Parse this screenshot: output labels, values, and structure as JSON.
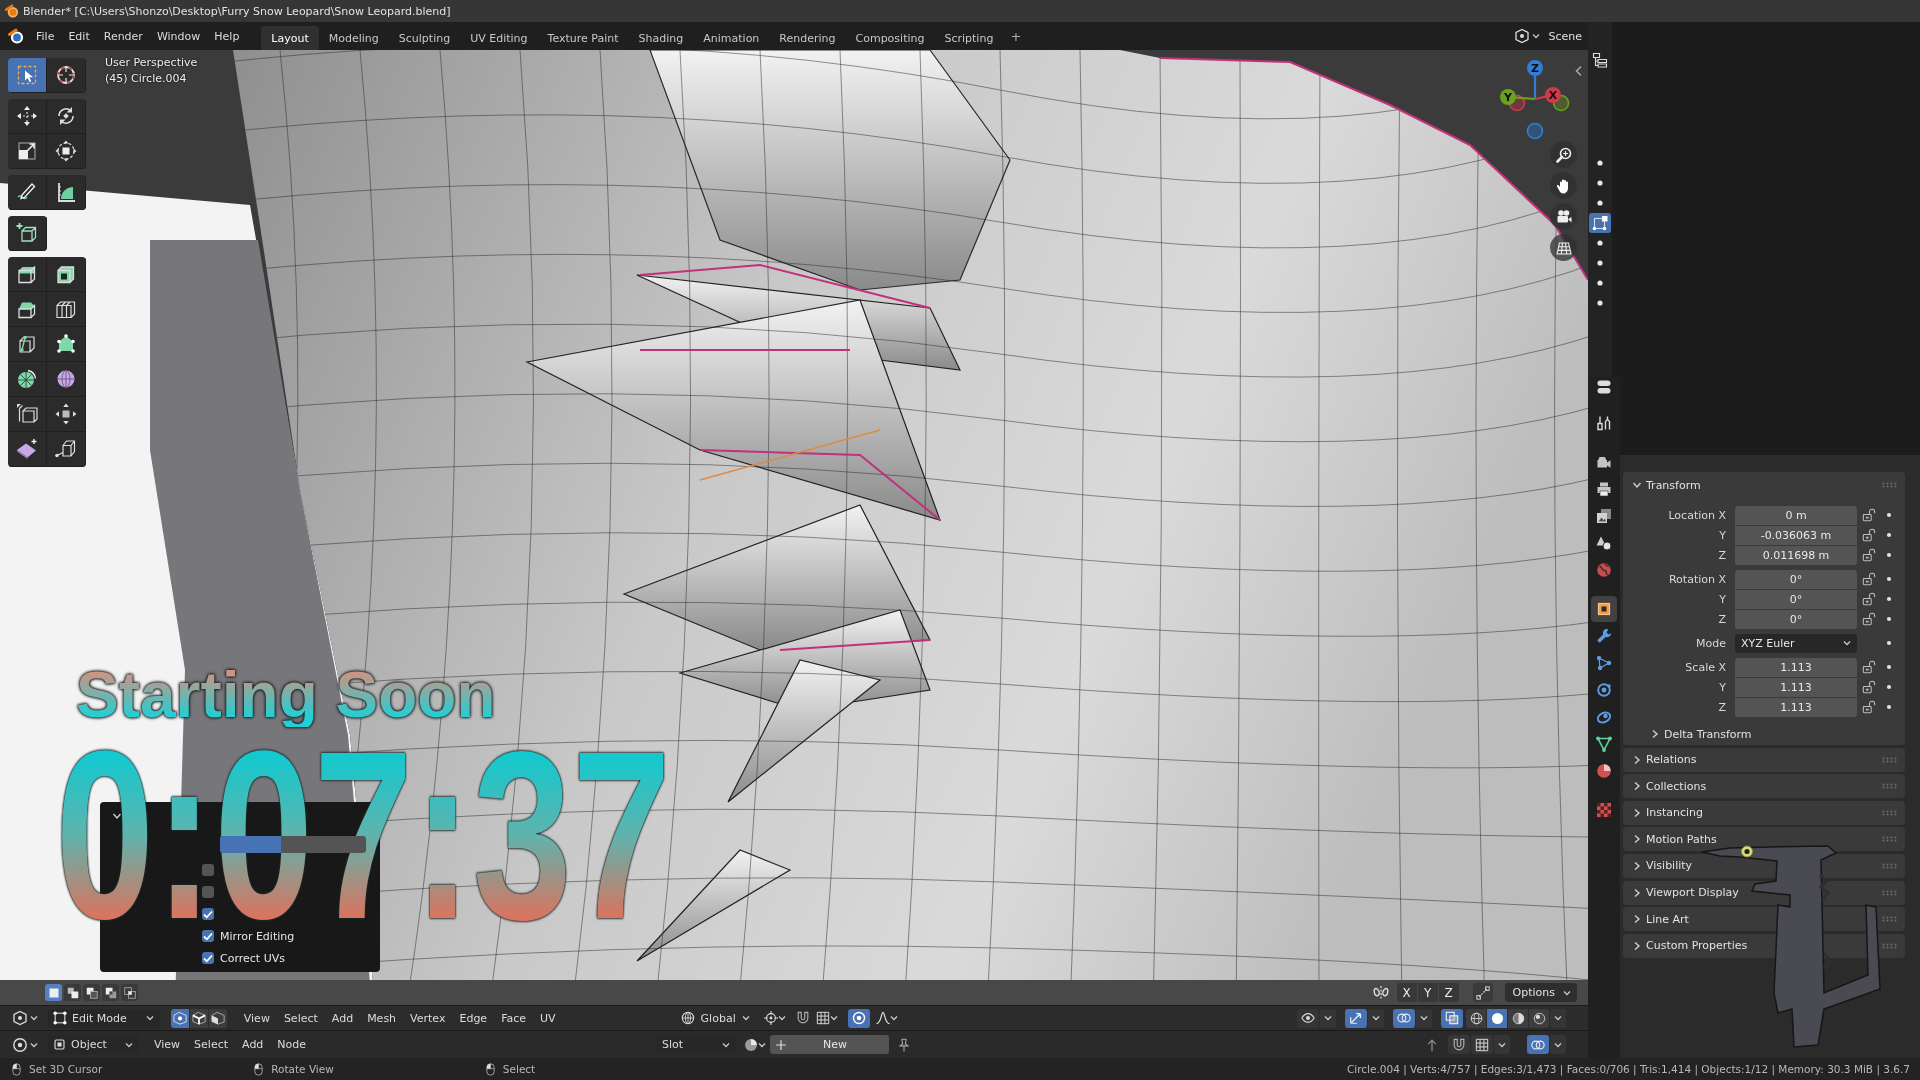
{
  "title_bar": {
    "title": "Blender* [C:\\Users\\Shonzo\\Desktop\\Furry Snow Leopard\\Snow Leopard.blend]"
  },
  "top_bar": {
    "menus": [
      "File",
      "Edit",
      "Render",
      "Window",
      "Help"
    ],
    "workspaces": [
      {
        "label": "Layout",
        "selected": true
      },
      {
        "label": "Modeling",
        "selected": false
      },
      {
        "label": "Sculpting",
        "selected": false
      },
      {
        "label": "UV Editing",
        "selected": false
      },
      {
        "label": "Texture Paint",
        "selected": false
      },
      {
        "label": "Shading",
        "selected": false
      },
      {
        "label": "Animation",
        "selected": false
      },
      {
        "label": "Rendering",
        "selected": false
      },
      {
        "label": "Compositing",
        "selected": false
      },
      {
        "label": "Scripting",
        "selected": false
      }
    ],
    "add_workspace": "+",
    "scene": "Scene"
  },
  "viewport": {
    "info": [
      "User Perspective",
      "(45) Circle.004"
    ],
    "tools": [
      [
        {
          "kind": "select_box",
          "selected": true
        },
        {
          "kind": "cursor",
          "selected": false
        }
      ],
      [
        {
          "kind": "move",
          "selected": false
        },
        {
          "kind": "rotate",
          "selected": false
        },
        {
          "kind": "scale",
          "selected": false
        },
        {
          "kind": "transform",
          "selected": false
        }
      ],
      [
        {
          "kind": "annotate",
          "selected": false
        },
        {
          "kind": "measure",
          "selected": false
        }
      ],
      [
        {
          "kind": "add_cube",
          "selected": false
        }
      ],
      [
        {
          "kind": "extrude",
          "selected": false
        },
        {
          "kind": "inset",
          "selected": false
        },
        {
          "kind": "bevel",
          "selected": false
        },
        {
          "kind": "loop_cut",
          "selected": false
        },
        {
          "kind": "knife",
          "selected": false
        },
        {
          "kind": "poly_build",
          "selected": false
        },
        {
          "kind": "spin",
          "selected": false
        },
        {
          "kind": "smooth",
          "selected": false
        },
        {
          "kind": "edge_slide",
          "selected": false
        },
        {
          "kind": "shrink_fatten",
          "selected": false
        },
        {
          "kind": "shear",
          "selected": false
        },
        {
          "kind": "rip",
          "selected": false
        }
      ]
    ],
    "gizmo_axes": [
      {
        "label": "Z",
        "color": "#2e7fd9"
      },
      {
        "label": "Y",
        "color": "#6aa11e"
      },
      {
        "label": "X",
        "color": "#d03a48"
      }
    ],
    "nav_buttons": [
      {
        "kind": "zoom"
      },
      {
        "kind": "pan"
      },
      {
        "kind": "camera"
      },
      {
        "kind": "ortho"
      }
    ],
    "select_modes": [
      {
        "kind": "replace",
        "selected": true
      },
      {
        "kind": "extend",
        "selected": false
      },
      {
        "kind": "subtract",
        "selected": false
      },
      {
        "kind": "invert",
        "selected": false
      },
      {
        "kind": "intersect",
        "selected": false
      }
    ],
    "mirror_axes": [
      "X",
      "Y",
      "Z"
    ],
    "options": "Options",
    "popover": {
      "slider": {
        "level": 0.42
      },
      "checkboxes": [
        {
          "checked": false
        },
        {
          "checked": false
        },
        {
          "checked": true
        },
        {
          "label": "Mirror Editing",
          "checked": true
        },
        {
          "label": "Correct UVs",
          "checked": true
        }
      ]
    }
  },
  "stream_overlay": {
    "heading": "Starting Soon",
    "timer": "0:07:37"
  },
  "viewport_header": {
    "mode": "Edit Mode",
    "select_modes": [
      {
        "kind": "vertex",
        "selected": true
      },
      {
        "kind": "edge",
        "selected": false
      },
      {
        "kind": "face",
        "selected": false
      }
    ],
    "menus": [
      "View",
      "Select",
      "Add",
      "Mesh",
      "Vertex",
      "Edge",
      "Face",
      "UV"
    ],
    "orientation": "Global",
    "proportional_editing": true,
    "toggles": [
      {
        "kind": "visibility",
        "on": false
      },
      {
        "kind": "gizmos",
        "on": true
      },
      {
        "kind": "overlays",
        "on": true
      },
      {
        "kind": "xray",
        "on": true
      }
    ],
    "shading": [
      {
        "kind": "wireframe",
        "selected": false
      },
      {
        "kind": "solid",
        "selected": true
      },
      {
        "kind": "material",
        "selected": false
      },
      {
        "kind": "rendered",
        "selected": false
      }
    ]
  },
  "shader_header": {
    "object": "Object",
    "menus": [
      "View",
      "Select",
      "Add",
      "Node"
    ],
    "slot": "Slot",
    "new_button": "New"
  },
  "outliner": {
    "items": [
      {
        "kind": "dot",
        "selected": false
      },
      {
        "kind": "dot",
        "selected": false
      },
      {
        "kind": "dot",
        "selected": false
      },
      {
        "kind": "mesh",
        "selected": true
      },
      {
        "kind": "dot",
        "selected": false
      },
      {
        "kind": "dot",
        "selected": false
      },
      {
        "kind": "dot",
        "selected": false
      },
      {
        "kind": "dot",
        "selected": false
      }
    ]
  },
  "properties": {
    "tabs": [
      [
        {
          "kind": "tool",
          "selected": false
        }
      ],
      [
        {
          "kind": "render",
          "selected": false
        },
        {
          "kind": "output",
          "selected": false
        },
        {
          "kind": "view_layer",
          "selected": false
        },
        {
          "kind": "scene",
          "selected": false
        },
        {
          "kind": "world",
          "selected": false
        }
      ],
      [
        {
          "kind": "object",
          "selected": true
        },
        {
          "kind": "modifiers",
          "selected": false
        },
        {
          "kind": "particles",
          "selected": false
        },
        {
          "kind": "physics",
          "selected": false
        },
        {
          "kind": "constraints",
          "selected": false
        },
        {
          "kind": "data",
          "selected": false
        },
        {
          "kind": "material",
          "selected": false
        }
      ],
      [
        {
          "kind": "texture",
          "selected": false
        }
      ]
    ],
    "transform": {
      "title": "Transform",
      "expanded": true,
      "groups": [
        [
          {
            "label": "Location X",
            "value": "0 m",
            "kind": "number"
          },
          {
            "label": "Y",
            "value": "-0.036063 m",
            "kind": "number"
          },
          {
            "label": "Z",
            "value": "0.011698 m",
            "kind": "number"
          }
        ],
        [
          {
            "label": "Rotation X",
            "value": "0°",
            "kind": "number"
          },
          {
            "label": "Y",
            "value": "0°",
            "kind": "number"
          },
          {
            "label": "Z",
            "value": "0°",
            "kind": "number"
          }
        ],
        [
          {
            "label": "Mode",
            "value": "XYZ Euler",
            "kind": "dropdown"
          }
        ],
        [
          {
            "label": "Scale X",
            "value": "1.113",
            "kind": "number"
          },
          {
            "label": "Y",
            "value": "1.113",
            "kind": "number"
          },
          {
            "label": "Z",
            "value": "1.113",
            "kind": "number"
          }
        ]
      ],
      "subpanel": {
        "title": "Delta Transform",
        "expanded": false
      }
    },
    "panels": [
      {
        "title": "Relations",
        "expanded": false
      },
      {
        "title": "Collections",
        "expanded": false
      },
      {
        "title": "Instancing",
        "expanded": false
      },
      {
        "title": "Motion Paths",
        "expanded": false
      },
      {
        "title": "Visibility",
        "expanded": false
      },
      {
        "title": "Viewport Display",
        "expanded": false
      },
      {
        "title": "Line Art",
        "expanded": false
      },
      {
        "title": "Custom Properties",
        "expanded": false
      }
    ]
  },
  "status_bar": {
    "hints": [
      "Set 3D Cursor",
      "Rotate View",
      "Select"
    ],
    "stats": "Circle.004 | Verts:4/757 | Edges:3/1,473 | Faces:0/706 | Tris:1,414 | Objects:1/12 | Memory: 30.3 MiB | 3.6.7"
  }
}
